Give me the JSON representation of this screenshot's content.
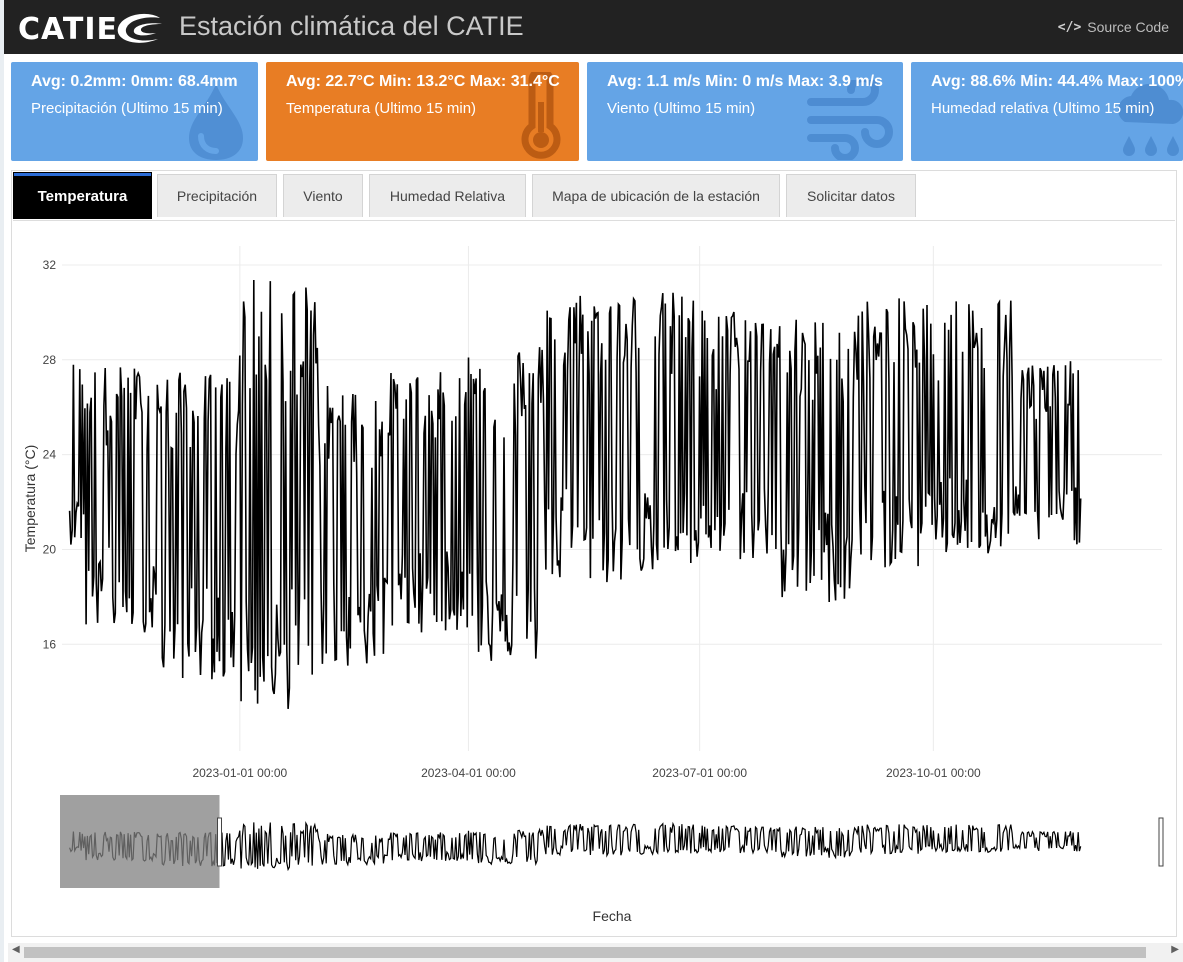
{
  "header": {
    "logo_text": "CATIE",
    "title": "Estación climática del CATIE",
    "source_label": "Source Code",
    "source_icon": "code-icon"
  },
  "cards": [
    {
      "main": "Avg: 0.2mm: 0mm: 68.4mm",
      "sub": "Precipitación (Ultimo 15 min)",
      "icon": "water-drop-icon",
      "color": "#64a4e6"
    },
    {
      "main": "Avg: 22.7°C Min: 13.2°C Max: 31.4°C",
      "sub": "Temperatura (Ultimo 15 min)",
      "icon": "thermometer-icon",
      "color": "#e87d24"
    },
    {
      "main": "Avg: 1.1 m/s Min: 0 m/s Max: 3.9 m/s",
      "sub": "Viento (Ultimo 15 min)",
      "icon": "wind-icon",
      "color": "#64a4e6"
    },
    {
      "main": "Avg: 88.6% Min: 44.4% Max: 100%",
      "sub": "Humedad relativa (Ultimo 15 min)",
      "icon": "rain-cloud-icon",
      "color": "#64a4e6"
    }
  ],
  "tabs": [
    {
      "label": "Temperatura",
      "active": true
    },
    {
      "label": "Precipitación",
      "active": false
    },
    {
      "label": "Viento",
      "active": false
    },
    {
      "label": "Humedad Relativa",
      "active": false
    },
    {
      "label": "Mapa de ubicación de la estación",
      "active": false
    },
    {
      "label": "Solicitar datos",
      "active": false
    }
  ],
  "chart_data": {
    "type": "line",
    "title": "",
    "ylabel": "Temperatura (°C)",
    "xlabel": "Fecha",
    "ylim": [
      11.5,
      32.8
    ],
    "xlim": [
      "2022-10-23",
      "2023-12-30"
    ],
    "yticks": [
      16,
      20,
      24,
      28,
      32
    ],
    "xticks": [
      "2023-01-01 00:00",
      "2023-04-01 00:00",
      "2023-07-01 00:00",
      "2023-10-01 00:00"
    ],
    "grid": true,
    "legend": "none",
    "color": "#000000",
    "series": [
      {
        "x_start": "2022-10-26",
        "x_end": "2023-11-28",
        "daily_range_note_omitted": true,
        "monthly": [
          {
            "month": "2022-11",
            "min": 16.5,
            "max": 27.8
          },
          {
            "month": "2022-12",
            "min": 14.5,
            "max": 27.5
          },
          {
            "month": "2023-01",
            "min": 13.2,
            "max": 31.4
          },
          {
            "month": "2023-02",
            "min": 15.0,
            "max": 27.0
          },
          {
            "month": "2023-03",
            "min": 16.5,
            "max": 27.5
          },
          {
            "month": "2023-04",
            "min": 15.2,
            "max": 28.8
          },
          {
            "month": "2023-05",
            "min": 18.5,
            "max": 31.0
          },
          {
            "month": "2023-06",
            "min": 19.0,
            "max": 30.9
          },
          {
            "month": "2023-07",
            "min": 19.5,
            "max": 30.2
          },
          {
            "month": "2023-08",
            "min": 17.7,
            "max": 29.8
          },
          {
            "month": "2023-09",
            "min": 19.2,
            "max": 30.6
          },
          {
            "month": "2023-10",
            "min": 19.6,
            "max": 30.7
          },
          {
            "month": "2023-11",
            "min": 20.2,
            "max": 28.0
          }
        ]
      }
    ],
    "rangeslider": {
      "visible": true,
      "selected": [
        "2022-10-26",
        "2022-12-24"
      ]
    }
  },
  "scrollbar": {
    "left_arrow": "◀",
    "right_arrow": "▶"
  }
}
